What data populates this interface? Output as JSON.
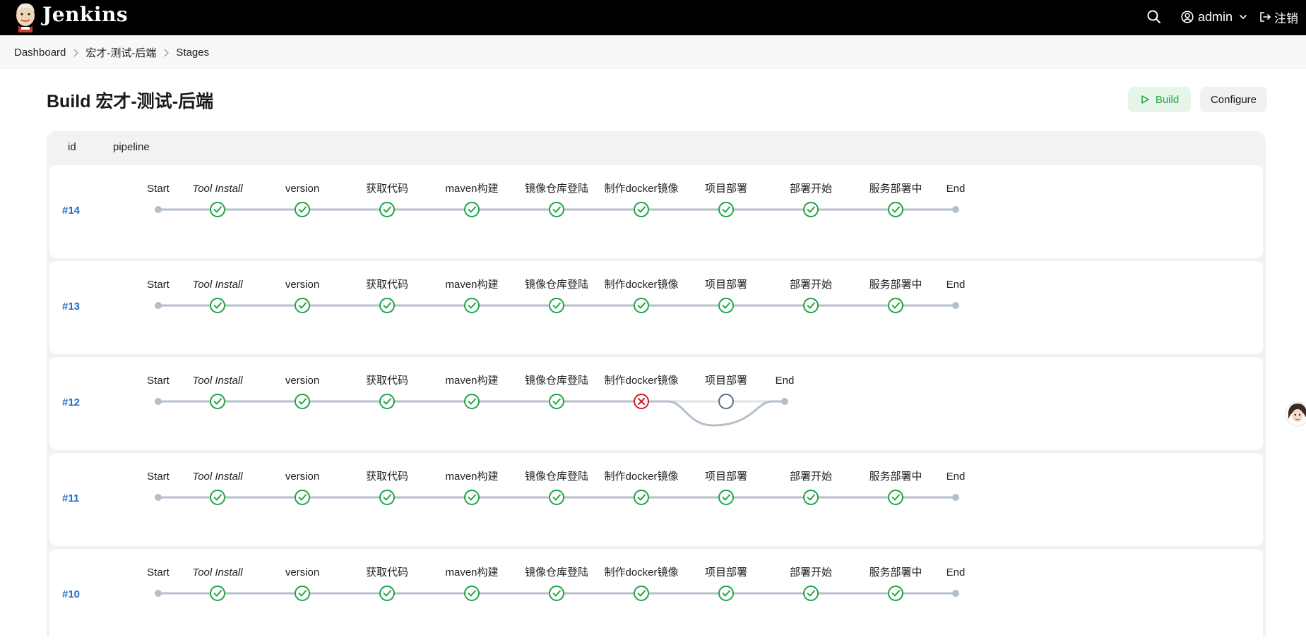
{
  "header": {
    "brand": "Jenkins",
    "user_name": "admin",
    "logout_label": "注销"
  },
  "breadcrumb": [
    "Dashboard",
    "宏才-测试-后端",
    "Stages"
  ],
  "page": {
    "title": "Build 宏才-测试-后端",
    "build_label": "Build",
    "configure_label": "Configure"
  },
  "table": {
    "columns": [
      "id",
      "pipeline"
    ]
  },
  "colors": {
    "success": "#1ea446",
    "failure": "#d11a2a",
    "pending": "#5a6b86",
    "track": "#b4bfcc",
    "link": "#1f6fc5"
  },
  "runs": [
    {
      "id": "#14",
      "stages": [
        {
          "label": "Start",
          "type": "start"
        },
        {
          "label": "Tool Install",
          "type": "success",
          "italic": true
        },
        {
          "label": "version",
          "type": "success"
        },
        {
          "label": "获取代码",
          "type": "success"
        },
        {
          "label": "maven构建",
          "type": "success"
        },
        {
          "label": "镜像仓库登陆",
          "type": "success"
        },
        {
          "label": "制作docker镜像",
          "type": "success"
        },
        {
          "label": "项目部署",
          "type": "success"
        },
        {
          "label": "部署开始",
          "type": "success"
        },
        {
          "label": "服务部署中",
          "type": "success"
        },
        {
          "label": "End",
          "type": "end"
        }
      ]
    },
    {
      "id": "#13",
      "stages": [
        {
          "label": "Start",
          "type": "start"
        },
        {
          "label": "Tool Install",
          "type": "success",
          "italic": true
        },
        {
          "label": "version",
          "type": "success"
        },
        {
          "label": "获取代码",
          "type": "success"
        },
        {
          "label": "maven构建",
          "type": "success"
        },
        {
          "label": "镜像仓库登陆",
          "type": "success"
        },
        {
          "label": "制作docker镜像",
          "type": "success"
        },
        {
          "label": "项目部署",
          "type": "success"
        },
        {
          "label": "部署开始",
          "type": "success"
        },
        {
          "label": "服务部署中",
          "type": "success"
        },
        {
          "label": "End",
          "type": "end"
        }
      ]
    },
    {
      "id": "#12",
      "branch": true,
      "stages": [
        {
          "label": "Start",
          "type": "start"
        },
        {
          "label": "Tool Install",
          "type": "success",
          "italic": true
        },
        {
          "label": "version",
          "type": "success"
        },
        {
          "label": "获取代码",
          "type": "success"
        },
        {
          "label": "maven构建",
          "type": "success"
        },
        {
          "label": "镜像仓库登陆",
          "type": "success"
        },
        {
          "label": "制作docker镜像",
          "type": "failure"
        },
        {
          "label": "项目部署",
          "type": "pending"
        },
        {
          "label": "End",
          "type": "end"
        }
      ]
    },
    {
      "id": "#11",
      "stages": [
        {
          "label": "Start",
          "type": "start"
        },
        {
          "label": "Tool Install",
          "type": "success",
          "italic": true
        },
        {
          "label": "version",
          "type": "success"
        },
        {
          "label": "获取代码",
          "type": "success"
        },
        {
          "label": "maven构建",
          "type": "success"
        },
        {
          "label": "镜像仓库登陆",
          "type": "success"
        },
        {
          "label": "制作docker镜像",
          "type": "success"
        },
        {
          "label": "项目部署",
          "type": "success"
        },
        {
          "label": "部署开始",
          "type": "success"
        },
        {
          "label": "服务部署中",
          "type": "success"
        },
        {
          "label": "End",
          "type": "end"
        }
      ]
    },
    {
      "id": "#10",
      "stages": [
        {
          "label": "Start",
          "type": "start"
        },
        {
          "label": "Tool Install",
          "type": "success",
          "italic": true
        },
        {
          "label": "version",
          "type": "success"
        },
        {
          "label": "获取代码",
          "type": "success"
        },
        {
          "label": "maven构建",
          "type": "success"
        },
        {
          "label": "镜像仓库登陆",
          "type": "success"
        },
        {
          "label": "制作docker镜像",
          "type": "success"
        },
        {
          "label": "项目部署",
          "type": "success"
        },
        {
          "label": "部署开始",
          "type": "success"
        },
        {
          "label": "服务部署中",
          "type": "success"
        },
        {
          "label": "End",
          "type": "end"
        }
      ]
    }
  ]
}
